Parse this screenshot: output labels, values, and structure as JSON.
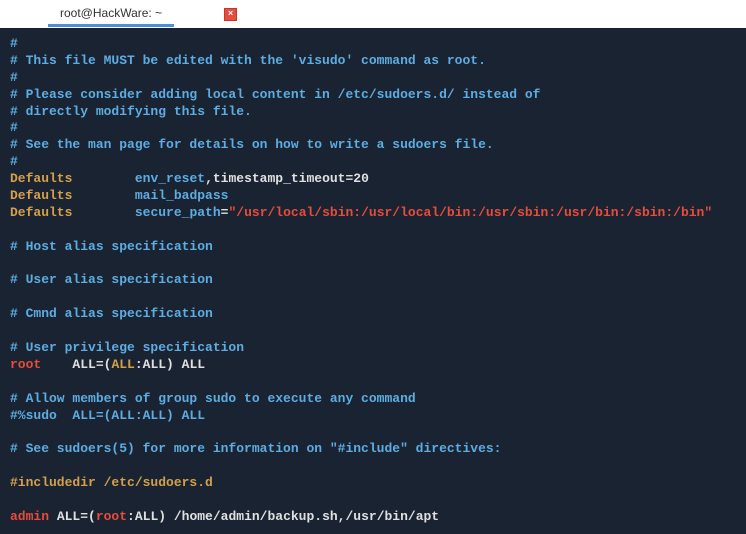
{
  "titlebar": {
    "tab_title": "root@HackWare: ~",
    "close_label": "×"
  },
  "lines": {
    "l1": "#",
    "l2": "# This file MUST be edited with the 'visudo' command as root.",
    "l3": "#",
    "l4": "# Please consider adding local content in /etc/sudoers.d/ instead of",
    "l5": "# directly modifying this file.",
    "l6": "#",
    "l7": "# See the man page for details on how to write a sudoers file.",
    "l8": "#",
    "l9a": "Defaults",
    "l9b": "        ",
    "l9c": "env_reset",
    "l9d": ",timestamp_timeout=20",
    "l10a": "Defaults",
    "l10b": "        ",
    "l10c": "mail_badpass",
    "l11a": "Defaults",
    "l11b": "        ",
    "l11c": "secure_path",
    "l11d": "=",
    "l11e": "\"/usr/local/sbin:/usr/local/bin:/usr/sbin:/usr/bin:/sbin:/bin\"",
    "l13": "# Host alias specification",
    "l15": "# User alias specification",
    "l17": "# Cmnd alias specification",
    "l19": "# User privilege specification",
    "l20a": "root",
    "l20b": "    ALL=(",
    "l20c": "ALL",
    "l20d": ":ALL) ALL",
    "l22": "# Allow members of group sudo to execute any command",
    "l23": "#%sudo  ALL=(ALL:ALL) ALL",
    "l25": "# See sudoers(5) for more information on \"#include\" directives:",
    "l27": "#includedir /etc/sudoers.d",
    "l29a": "admin",
    "l29b": " ALL=(",
    "l29c": "root",
    "l29d": ":ALL) /home/admin/backup.sh,/usr/bin/apt"
  }
}
